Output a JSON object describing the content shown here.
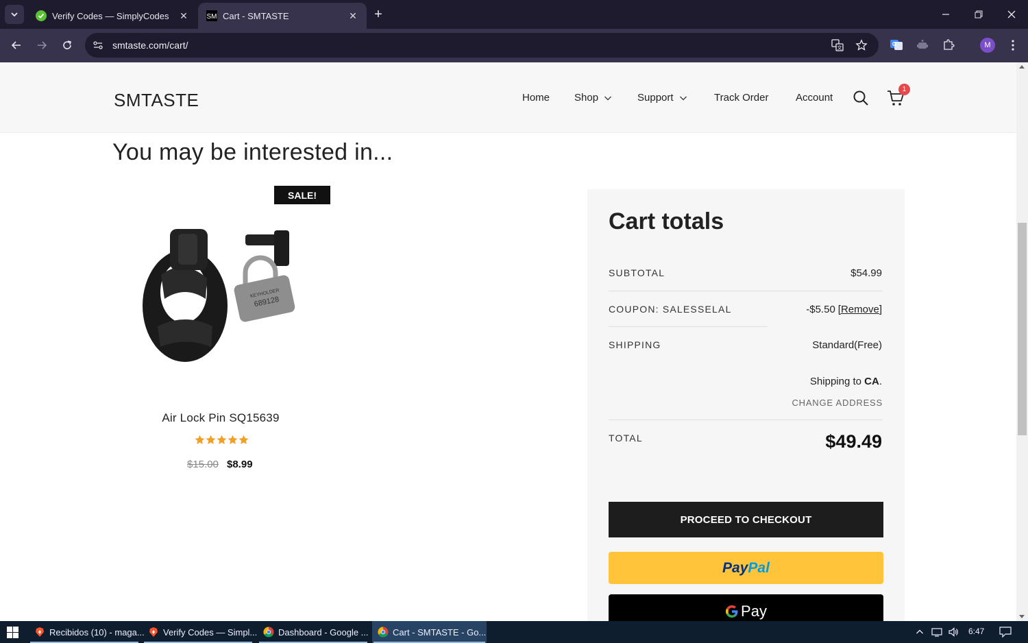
{
  "browser": {
    "tabs": [
      {
        "title": "Verify Codes — SimplyCodes",
        "active": false
      },
      {
        "title": "Cart - SMTASTE",
        "active": true
      }
    ],
    "url": "smtaste.com/cart/",
    "profile_initial": "M"
  },
  "header": {
    "logo": "SMTASTE",
    "nav": [
      "Home",
      "Shop",
      "Support",
      "Track Order",
      "Account"
    ],
    "cart_count": "1"
  },
  "recommendations": {
    "title": "You may be interested in...",
    "product": {
      "badge": "SALE!",
      "name": "Air Lock Pin SQ15639",
      "rating": 5,
      "old_price": "$15.00",
      "price": "$8.99",
      "image_text": [
        "KEYHOLDER",
        "689128"
      ]
    }
  },
  "cart_totals": {
    "title": "Cart totals",
    "subtotal_label": "SUBTOTAL",
    "subtotal_value": "$54.99",
    "coupon_label": "COUPON: SALESSELAL",
    "coupon_value": "-$5.50",
    "coupon_remove": "[Remove]",
    "shipping_label": "SHIPPING",
    "shipping_value": "Standard(Free)",
    "shipping_to_prefix": "Shipping to",
    "shipping_to_country": "CA",
    "change_address": "CHANGE ADDRESS",
    "total_label": "TOTAL",
    "total_value": "$49.49",
    "checkout_button": "PROCEED TO CHECKOUT",
    "paypal_pay": "Pay",
    "paypal_pal": "Pal",
    "gpay_g": "G",
    "gpay_pay": "Pay"
  },
  "taskbar": {
    "items": [
      "Recibidos (10) - maga...",
      "Verify Codes — Simpl...",
      "Dashboard - Google ...",
      "Cart - SMTASTE - Go..."
    ],
    "time": "6:47"
  },
  "colors": {
    "accent_badge": "#e5484d",
    "paypal_bg": "#ffc439",
    "star": "#f0a028"
  }
}
